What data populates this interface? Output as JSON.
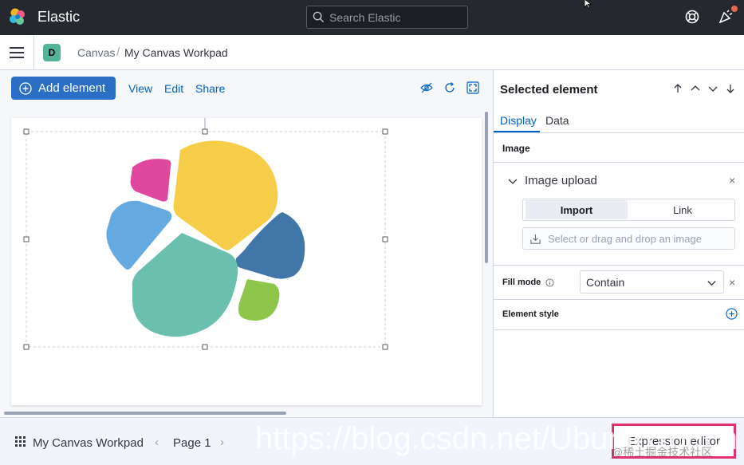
{
  "header": {
    "brand": "Elastic",
    "search_placeholder": "Search Elastic"
  },
  "breadcrumbs": {
    "avatar_letter": "D",
    "items": [
      "Canvas",
      "My Canvas Workpad"
    ],
    "separator": "/"
  },
  "toolbar": {
    "add_element_label": "Add element",
    "links": [
      "View",
      "Edit",
      "Share"
    ]
  },
  "footer": {
    "workpad_name": "My Canvas Workpad",
    "page_label": "Page 1",
    "expression_editor_label": "Expression editor",
    "watermark": "https://blog.csdn.net/UbuntuTouch",
    "watermark_sub": "@稀土掘金技术社区"
  },
  "sidebar": {
    "title": "Selected element",
    "tabs": [
      "Display",
      "Data"
    ],
    "image_section_label": "Image",
    "image_upload_label": "Image upload",
    "upload_options": [
      "Import",
      "Link"
    ],
    "dropzone_text": "Select or drag and drop an image",
    "fill_mode_label": "Fill mode",
    "fill_mode_value": "Contain",
    "element_style_label": "Element style"
  },
  "colors": {
    "accent": "#2a6fc5",
    "header_bg": "#25282f",
    "highlight": "#e5306f"
  }
}
